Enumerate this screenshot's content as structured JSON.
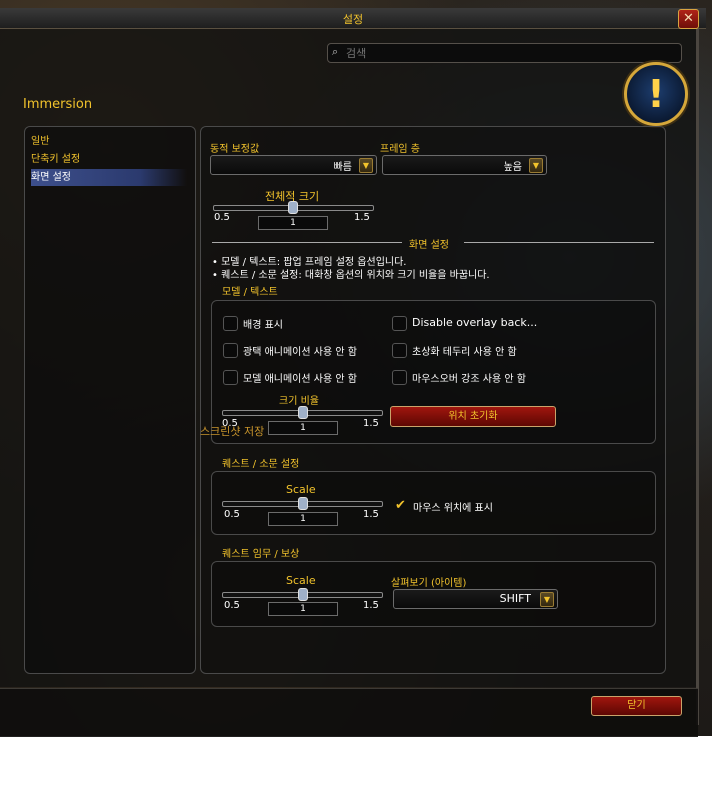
{
  "window": {
    "title": "설정",
    "close_icon": "✕"
  },
  "search": {
    "placeholder": "검색",
    "value": ""
  },
  "addon_title": "Immersion",
  "sidebar": {
    "items": [
      {
        "label": "일반",
        "selected": false
      },
      {
        "label": "단축키 설정",
        "selected": false
      },
      {
        "label": "화면 설정",
        "selected": true
      }
    ]
  },
  "main": {
    "dynamic_scale": {
      "label": "동적 보정값",
      "value": "빠름"
    },
    "frame_strata": {
      "label": "프레임 층",
      "value": "높음"
    },
    "overall_scale": {
      "label": "전체적 크기",
      "min": "0.5",
      "max": "1.5",
      "value": "1"
    },
    "display_header": "화면 설정",
    "bullets": [
      "• 모델 / 텍스트: 팝업 프레임 설정 옵션입니다.",
      "• 퀘스트 / 소문 설정: 대화창 옵션의 위치와 크기 비율을 바꿉니다."
    ],
    "model_text": {
      "header": "모델 / 텍스트",
      "checkboxes": [
        {
          "label": "배경 표시",
          "checked": false
        },
        {
          "label": "Disable overlay back...",
          "checked": false
        },
        {
          "label": "광택 애니메이션 사용 안 함",
          "checked": false
        },
        {
          "label": "초상화 테두리 사용 안 함",
          "checked": false
        },
        {
          "label": "모델 애니메이션 사용 안 함",
          "checked": false
        },
        {
          "label": "마우스오버 강조 사용 안 함",
          "checked": false
        }
      ],
      "scale": {
        "label": "크기 비율",
        "min": "0.5",
        "max": "1.5",
        "value": "1"
      },
      "reset_button": "위치 초기화",
      "screenshot_label": "스크린샷 저장"
    },
    "quest_gossip": {
      "header": "퀘스트 / 소문 설정",
      "scale": {
        "label": "Scale",
        "min": "0.5",
        "max": "1.5",
        "value": "1"
      },
      "mouse_checkbox": {
        "label": "마우스 위치에 표시",
        "checked": true
      }
    },
    "quest_reward": {
      "header": "퀘스트 임무 / 보상",
      "scale": {
        "label": "Scale",
        "min": "0.5",
        "max": "1.5",
        "value": "1"
      },
      "inspect": {
        "label": "살펴보기 (아이템)",
        "value": "SHIFT"
      }
    }
  },
  "footer": {
    "close_button": "닫기"
  },
  "colors": {
    "accent_gold": "#f2c32c",
    "button_red": "#8b0f08",
    "selected_blue": "#3d4f8c"
  }
}
